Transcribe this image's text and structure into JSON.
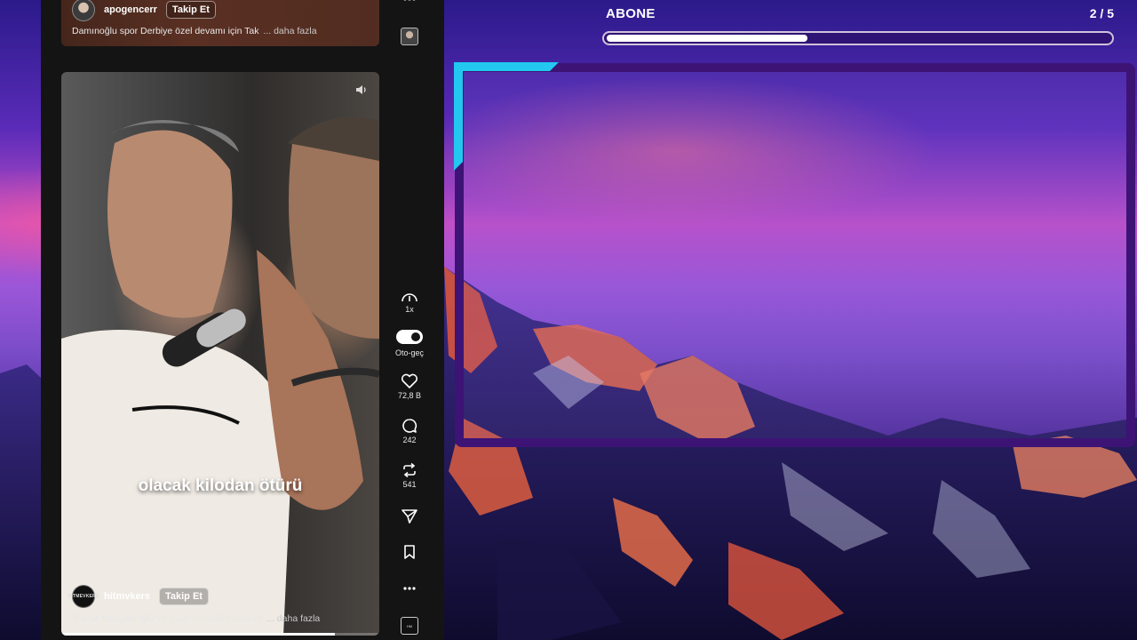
{
  "previous_post": {
    "author": "apogencerr",
    "follow_label": "Takip Et",
    "caption": "Damınoğlu spor Derbiye özel devamı için Tak",
    "more_label": "... daha fazla"
  },
  "current_post": {
    "author": "hitmvkers",
    "author_logo_text": "HITMEVKERS",
    "follow_label": "Takip Et",
    "caption": "Toprak Razgatlıoğlu ve Zayn Sofuoğlu yanşırs",
    "more_label": "... daha fazla",
    "subtitle": "olacak kilodan ötürü",
    "progress": 0.86
  },
  "rail": {
    "speed_label": "1x",
    "autoplay_label": "Oto-geç",
    "likes": "72,8 B",
    "comments": "242",
    "reposts": "541"
  },
  "overlay": {
    "title": "ABONE",
    "count": "2 / 5",
    "progress": 0.4,
    "accent_color": "#22c8f0",
    "frame_color": "#3d1375"
  }
}
